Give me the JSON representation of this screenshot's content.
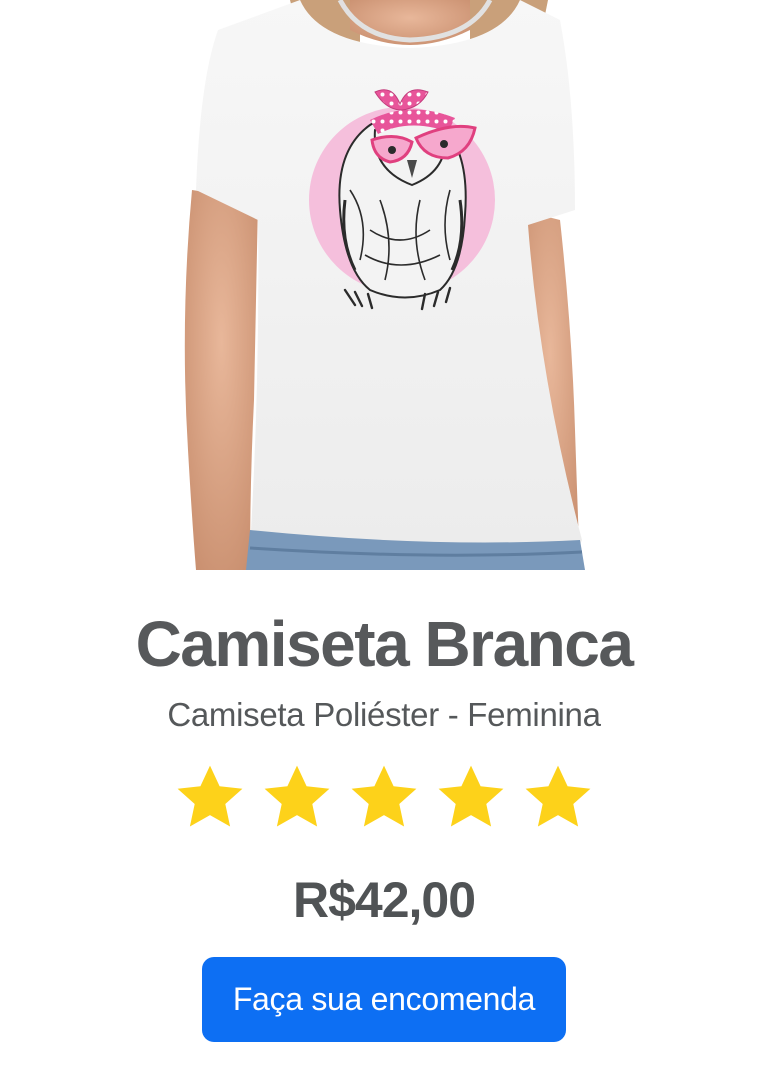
{
  "product": {
    "title": "Camiseta Branca",
    "subtitle": "Camiseta Poliéster - Feminina",
    "rating": 5,
    "rating_max": 5,
    "price": "R$42,00"
  },
  "cta": {
    "label": "Faça sua encomenda"
  },
  "colors": {
    "title_text": "#57595b",
    "star": "#fdd21a",
    "button": "#0d6ff3",
    "design_circle": "#f5bfdc"
  },
  "icons": {
    "rating": "star-icon"
  }
}
